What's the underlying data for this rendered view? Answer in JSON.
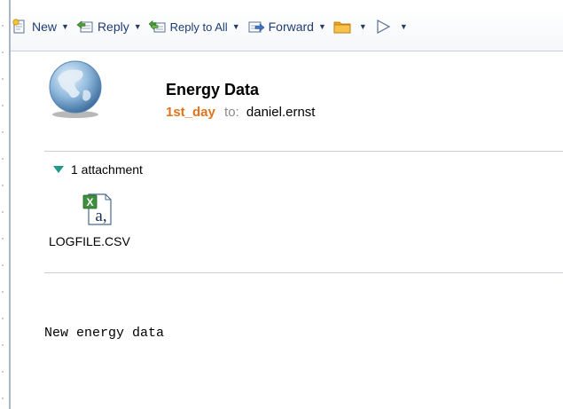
{
  "toolbar": {
    "new_label": "New",
    "reply_label": "Reply",
    "reply_all_label": "Reply to All",
    "forward_label": "Forward"
  },
  "message": {
    "subject": "Energy Data",
    "from": "1st_day",
    "to_label": "to:",
    "to": "daniel.ernst",
    "body": "New energy data"
  },
  "attachments": {
    "summary": "1 attachment",
    "files": [
      {
        "name": "LOGFILE.CSV",
        "icon": "excel-csv-file-icon"
      }
    ]
  },
  "colors": {
    "toolbar_text": "#1e3c73",
    "sender": "#e1731a",
    "expander": "#1f9a8a",
    "rule": "#c9ced6"
  }
}
